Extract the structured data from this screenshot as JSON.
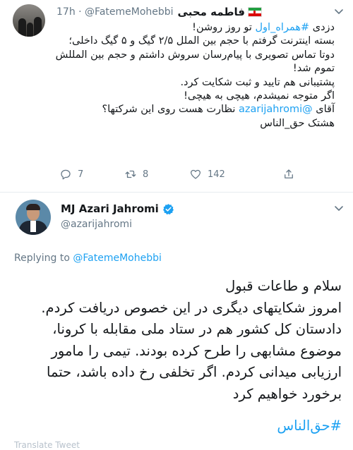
{
  "tweet1": {
    "display_name": "فاطمه محبی",
    "handle": "@FatemeMohebbi",
    "time": "17h",
    "text_lines": [
      {
        "pre": "دزدی ",
        "tag": "#همراه_اول",
        "post": " تو روز روشن!"
      },
      {
        "pre": "بسته اینترنت گرفتم با حجم بین الملل ۲/۵ گیگ و ۵ گیگ داخلی؛",
        "tag": "",
        "post": ""
      },
      {
        "pre": "دوتا تماس تصویری با پیام‌رسان سروش داشتم و حجم بین المللش تموم شد!",
        "tag": "",
        "post": ""
      },
      {
        "pre": "پشتیبانی هم تایید و ثبت شکایت کرد.",
        "tag": "",
        "post": ""
      },
      {
        "pre": "اگر متوجه نمیشدم، هیچی به هیچی!",
        "tag": "",
        "post": ""
      },
      {
        "pre": "آقای ",
        "tag": "@azarijahromi",
        "post": " نظارت هست روی این شرکتها؟"
      },
      {
        "pre": "هشتک حق_الناس",
        "tag": "",
        "post": ""
      }
    ],
    "replies": "7",
    "retweets": "8",
    "likes": "142"
  },
  "tweet2": {
    "display_name": "MJ Azari Jahromi",
    "handle": "@azarijahromi",
    "replying_prefix": "Replying to",
    "replying_to": "@FatemeMohebbi",
    "text_lines": [
      "سلام و طاعات قبول",
      "امروز شکایتهای دیگری در این خصوص دریافت کردم. دادستان کل کشور هم در ستاد ملی مقابله با کرونا، موضوع مشابهی را طرح کرده بودند. تیمی را مامور ارزیابی میدانی کردم. اگر تخلفی رخ داده باشد، حتما برخورد خواهیم کرد"
    ],
    "hashtag": "#حق‌الناس",
    "bottom_peek": "Translate Tweet"
  },
  "colors": {
    "link": "#1da1f2",
    "muted": "#657786",
    "divider": "#e6ecf0"
  },
  "icons": {
    "reply": "reply-icon",
    "retweet": "retweet-icon",
    "like": "heart-icon",
    "share": "share-icon",
    "more": "chevron-down-icon",
    "verified": "verified-badge-icon"
  }
}
